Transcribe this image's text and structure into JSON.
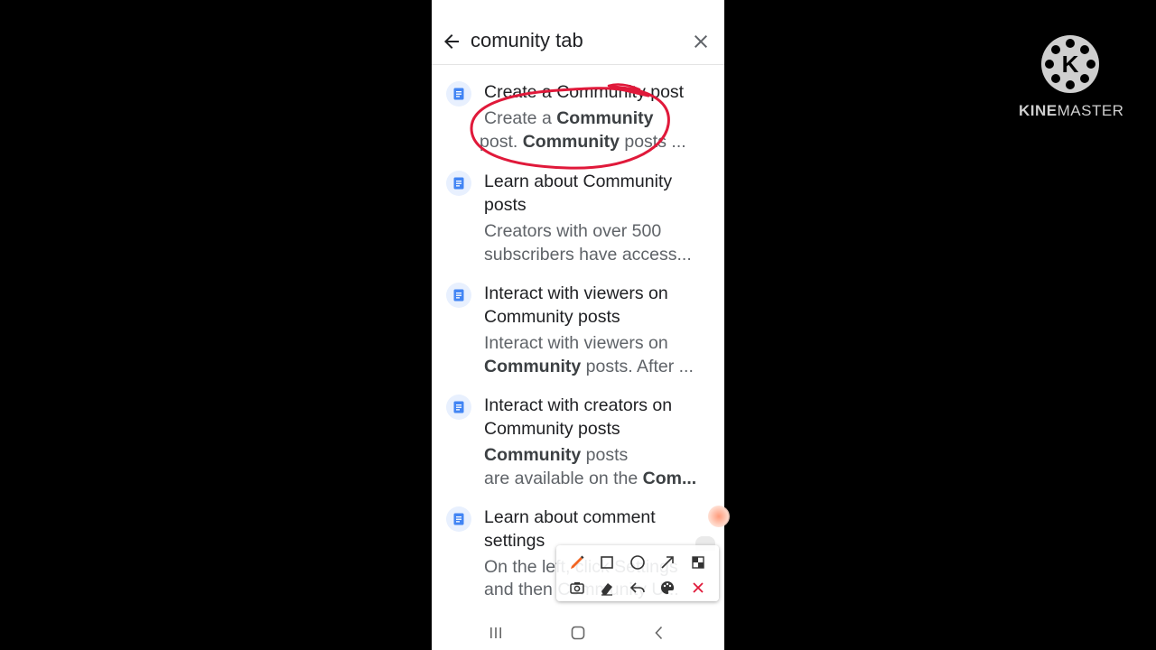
{
  "search": {
    "query": "comunity tab"
  },
  "results": [
    {
      "title": "Create a Community post",
      "snippet_parts": [
        {
          "t": "Create a ",
          "b": false
        },
        {
          "t": "Community",
          "b": true
        },
        {
          "t": " post. ",
          "b": false
        },
        {
          "t": "Community",
          "b": true
        },
        {
          "t": " posts ...",
          "b": false
        }
      ]
    },
    {
      "title": "Learn about Community posts",
      "snippet_parts": [
        {
          "t": "Creators with over 500 subscribers have access...",
          "b": false
        }
      ]
    },
    {
      "title": "Interact with viewers on Community posts",
      "snippet_parts": [
        {
          "t": "Interact with viewers on ",
          "b": false
        },
        {
          "t": "Community",
          "b": true
        },
        {
          "t": " posts. After ...",
          "b": false
        }
      ]
    },
    {
      "title": "Interact with creators on Community posts",
      "snippet_line1_parts": [
        {
          "t": "Community",
          "b": true
        },
        {
          "t": " posts",
          "b": false
        }
      ],
      "snippet_line2_parts": [
        {
          "t": "are available on the ",
          "b": false
        },
        {
          "t": "Com...",
          "b": true
        }
      ]
    },
    {
      "title": "Learn about comment settings",
      "snippet_line1": "On the left, click Settings",
      "snippet_line2": "and then Community U..."
    }
  ],
  "watermark": {
    "brand_bold": "KINE",
    "brand_rest": "MASTER",
    "logo_letter": "K"
  },
  "colors": {
    "annotation_red": "#e0193a",
    "icon_blue": "#4285f4",
    "icon_bg": "#e8f0fe"
  }
}
